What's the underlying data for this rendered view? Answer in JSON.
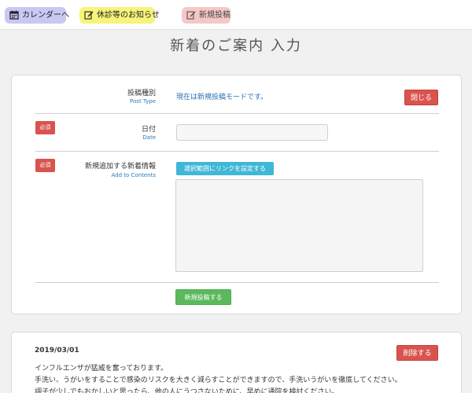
{
  "topnav": {
    "calendar_label": "カレンダーへ",
    "holiday_label": "休診等のお知らせ",
    "newpost_label": "新規投稿"
  },
  "page_title": "新着のご案内 入力",
  "form": {
    "post_type": {
      "label": "投稿種別",
      "label_en": "Post Type",
      "value": "現在は新規投稿モードです。"
    },
    "close_button": "閉じる",
    "date": {
      "required_badge": "必須",
      "label": "日付",
      "label_en": "Date",
      "value": "",
      "placeholder": ""
    },
    "content": {
      "required_badge": "必須",
      "label": "新規追加する新着情報",
      "label_en": "Add to Contents",
      "link_button": "選択範囲にリンクを設定する",
      "value": ""
    },
    "submit_button": "新規投稿する"
  },
  "post": {
    "date": "2019/03/01",
    "delete_button": "削除する",
    "lines": [
      "インフルエンザが猛威を奮っております。",
      "手洗い、うがいをすることで感染のリスクを大きく減らすことができますので、手洗いうがいを徹底してください。",
      "調子が少しでもおかしいと思ったら、他の人にうつさないために、早めに通院を検討ください。"
    ]
  },
  "colors": {
    "calendar_pill": "#c9c7f3",
    "holiday_pill": "#f6f47a",
    "newpost_pill": "#f5c7c7",
    "danger": "#d9534f",
    "info": "#3fb7d6",
    "success": "#5cb85c",
    "link_blue": "#2a6fb0"
  }
}
